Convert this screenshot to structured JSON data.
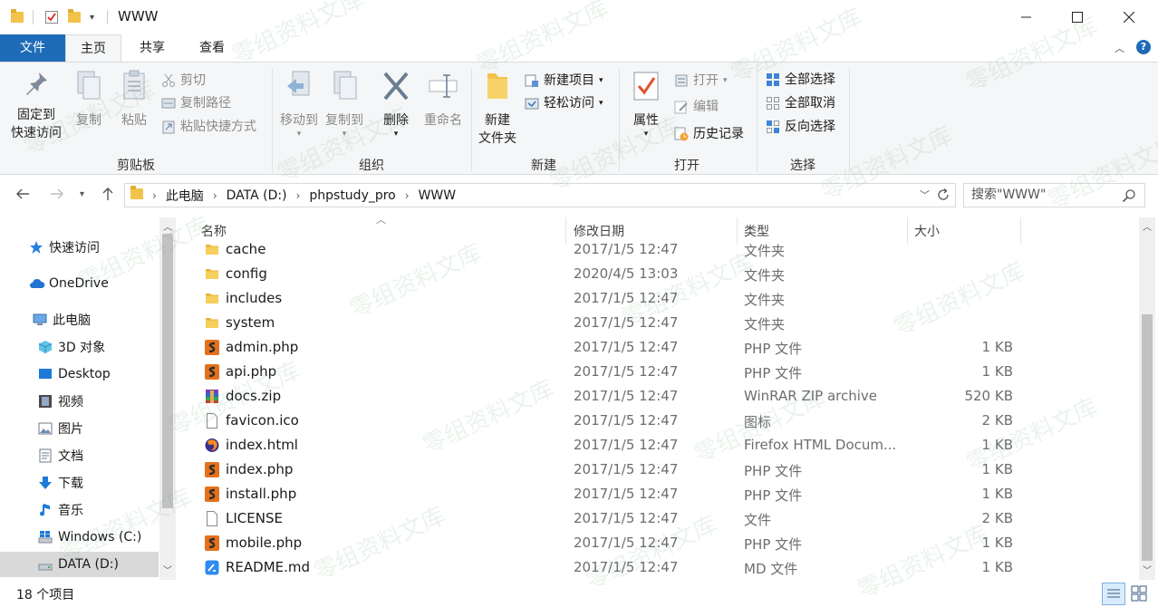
{
  "window": {
    "title": "WWW"
  },
  "ribbon_tabs": [
    "文件",
    "主页",
    "共享",
    "查看"
  ],
  "clipboard": {
    "pin_line1": "固定到",
    "pin_line2": "快速访问",
    "copy": "复制",
    "paste": "粘贴",
    "cut": "剪切",
    "copy_path": "复制路径",
    "paste_shortcut": "粘贴快捷方式",
    "label": "剪贴板"
  },
  "organize": {
    "move_to": "移动到",
    "copy_to": "复制到",
    "delete": "删除",
    "rename": "重命名",
    "label": "组织"
  },
  "new_group": {
    "new_folder_line1": "新建",
    "new_folder_line2": "文件夹",
    "new_item": "新建项目",
    "easy_access": "轻松访问",
    "label": "新建"
  },
  "open_group": {
    "properties": "属性",
    "open": "打开",
    "edit": "编辑",
    "history": "历史记录",
    "label": "打开"
  },
  "select_group": {
    "select_all": "全部选择",
    "select_none": "全部取消",
    "invert": "反向选择",
    "label": "选择"
  },
  "breadcrumb": [
    "此电脑",
    "DATA (D:)",
    "phpstudy_pro",
    "WWW"
  ],
  "search": {
    "placeholder": "搜索\"WWW\""
  },
  "sidebar": {
    "items": [
      {
        "label": "快速访问"
      },
      {
        "label": "OneDrive"
      },
      {
        "label": "此电脑"
      },
      {
        "label": "3D 对象"
      },
      {
        "label": "Desktop"
      },
      {
        "label": "视频"
      },
      {
        "label": "图片"
      },
      {
        "label": "文档"
      },
      {
        "label": "下载"
      },
      {
        "label": "音乐"
      },
      {
        "label": "Windows (C:)"
      },
      {
        "label": "DATA (D:)"
      }
    ]
  },
  "columns": {
    "name": "名称",
    "date": "修改日期",
    "type": "类型",
    "size": "大小"
  },
  "files": [
    {
      "icon": "folder-icon",
      "name": "cache",
      "date": "2017/1/5 12:47",
      "type": "文件夹",
      "size": ""
    },
    {
      "icon": "folder-icon",
      "name": "config",
      "date": "2020/4/5 13:03",
      "type": "文件夹",
      "size": ""
    },
    {
      "icon": "folder-icon",
      "name": "includes",
      "date": "2017/1/5 12:47",
      "type": "文件夹",
      "size": ""
    },
    {
      "icon": "folder-icon",
      "name": "system",
      "date": "2017/1/5 12:47",
      "type": "文件夹",
      "size": ""
    },
    {
      "icon": "php-file-icon",
      "name": "admin.php",
      "date": "2017/1/5 12:47",
      "type": "PHP 文件",
      "size": "1 KB"
    },
    {
      "icon": "php-file-icon",
      "name": "api.php",
      "date": "2017/1/5 12:47",
      "type": "PHP 文件",
      "size": "1 KB"
    },
    {
      "icon": "zip-file-icon",
      "name": "docs.zip",
      "date": "2017/1/5 12:47",
      "type": "WinRAR ZIP archive",
      "size": "520 KB"
    },
    {
      "icon": "generic-file-icon",
      "name": "favicon.ico",
      "date": "2017/1/5 12:47",
      "type": "图标",
      "size": "2 KB"
    },
    {
      "icon": "html-file-icon",
      "name": "index.html",
      "date": "2017/1/5 12:47",
      "type": "Firefox HTML Docum...",
      "size": "1 KB"
    },
    {
      "icon": "php-file-icon",
      "name": "index.php",
      "date": "2017/1/5 12:47",
      "type": "PHP 文件",
      "size": "1 KB"
    },
    {
      "icon": "php-file-icon",
      "name": "install.php",
      "date": "2017/1/5 12:47",
      "type": "PHP 文件",
      "size": "1 KB"
    },
    {
      "icon": "generic-file-icon",
      "name": "LICENSE",
      "date": "2017/1/5 12:47",
      "type": "文件",
      "size": "2 KB"
    },
    {
      "icon": "php-file-icon",
      "name": "mobile.php",
      "date": "2017/1/5 12:47",
      "type": "PHP 文件",
      "size": "1 KB"
    },
    {
      "icon": "md-file-icon",
      "name": "README.md",
      "date": "2017/1/5 12:47",
      "type": "MD 文件",
      "size": "1 KB"
    }
  ],
  "status": {
    "item_count": "18 个项目"
  },
  "watermark": "零组资料文库",
  "colors": {
    "accent": "#1e6bb8",
    "folder": "#f2c24a",
    "php": "#e5711b"
  }
}
